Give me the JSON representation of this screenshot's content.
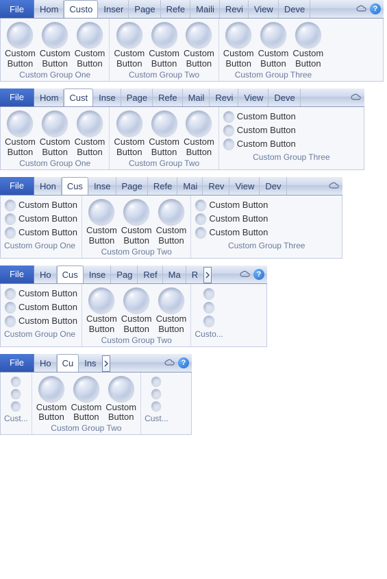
{
  "file_label": "File",
  "tabs": {
    "0": [
      "Hom",
      "Custo",
      "Inser",
      "Page",
      "Refe",
      "Maili",
      "Revi",
      "View",
      "Deve"
    ],
    "1": [
      "Hom",
      "Cust",
      "Inse",
      "Page",
      "Refe",
      "Mail",
      "Revi",
      "View",
      "Deve"
    ],
    "2": [
      "Hon",
      "Cus",
      "Inse",
      "Page",
      "Refe",
      "Mai",
      "Rev",
      "View",
      "Dev"
    ],
    "3": [
      "Ho",
      "Cus",
      "Inse",
      "Pag",
      "Ref",
      "Ma",
      "R"
    ],
    "4": [
      "Ho",
      "Cu",
      "Ins"
    ]
  },
  "button_label_line1": "Custom",
  "button_label_line2": "Button",
  "small_button_label": "Custom Button",
  "group_labels": {
    "g1": "Custom Group One",
    "g2": "Custom Group Two",
    "g3": "Custom Group Three",
    "g3_short": "Custom Group Three",
    "custo": "Custo...",
    "cust": "Cust..."
  },
  "help_glyph": "?"
}
